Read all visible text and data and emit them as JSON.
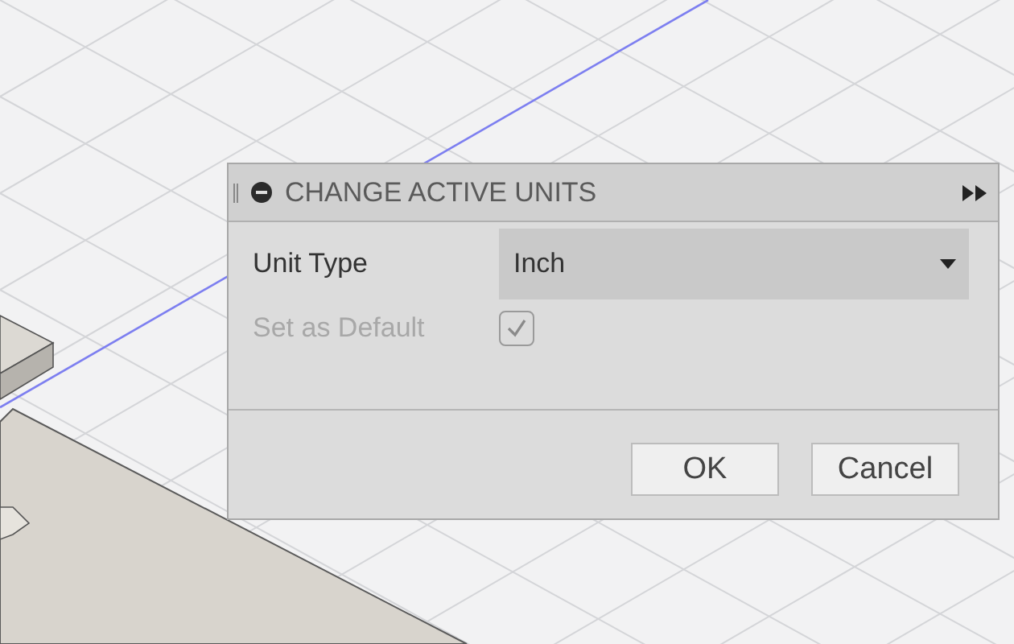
{
  "dialog": {
    "title": "CHANGE ACTIVE UNITS",
    "unit_type": {
      "label": "Unit Type",
      "value": "Inch"
    },
    "set_as_default": {
      "label": "Set as Default",
      "checked": true,
      "disabled": true
    },
    "buttons": [
      "OK",
      "Cancel"
    ]
  }
}
